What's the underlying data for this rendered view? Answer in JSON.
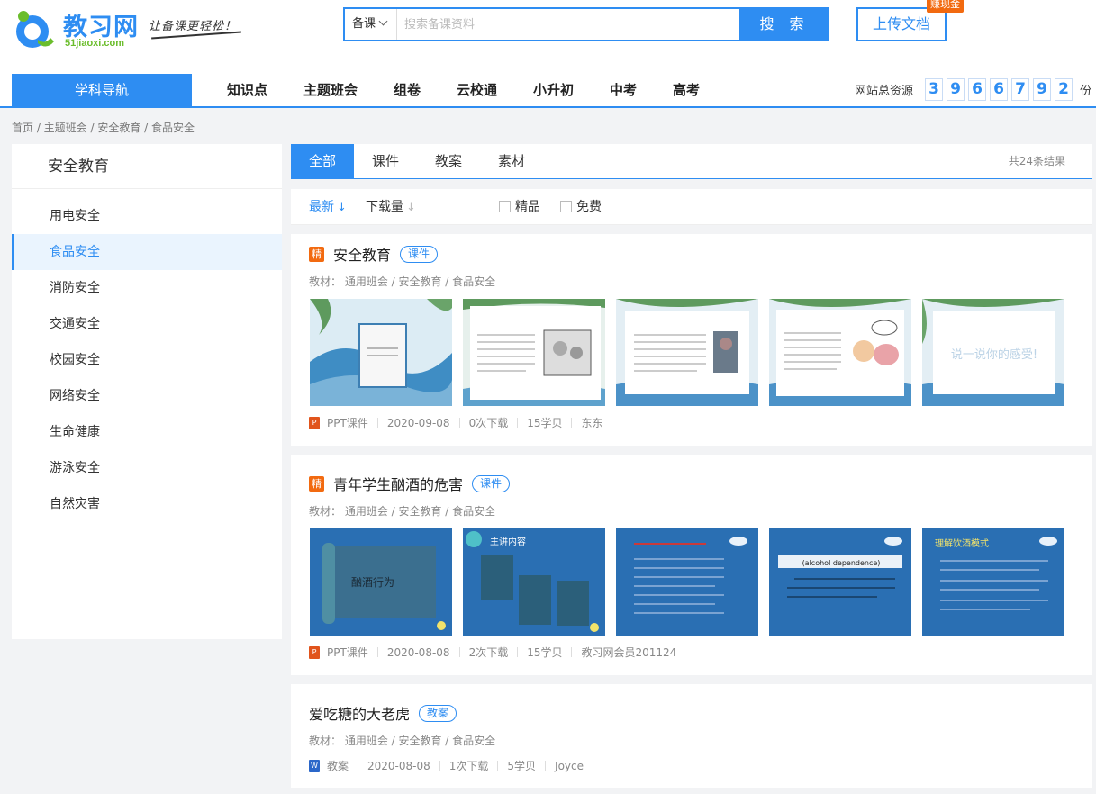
{
  "header": {
    "logo_text": "教习网",
    "logo_domain": "51jiaoxi.com",
    "slogan": "让备课更轻松！",
    "search": {
      "category": "备课",
      "placeholder": "搜索备课资料",
      "button": "搜 索"
    },
    "upload": {
      "label": "上传文档",
      "badge": "赚现金"
    }
  },
  "nav": {
    "subject_nav": "学科导航",
    "items": [
      "知识点",
      "主题班会",
      "组卷",
      "云校通",
      "小升初",
      "中考",
      "高考"
    ],
    "total_label": "网站总资源",
    "total_digits": [
      "3",
      "9",
      "6",
      "6",
      "7",
      "9",
      "2"
    ],
    "total_unit": "份"
  },
  "breadcrumb": "首页 /  主题班会 / 安全教育 / 食品安全",
  "sidebar": {
    "title": "安全教育",
    "items": [
      "用电安全",
      "食品安全",
      "消防安全",
      "交通安全",
      "校园安全",
      "网络安全",
      "生命健康",
      "游泳安全",
      "自然灾害"
    ],
    "active_index": 1
  },
  "tabs": {
    "items": [
      "全部",
      "课件",
      "教案",
      "素材"
    ],
    "active_index": 0,
    "result_count": "共24条结果"
  },
  "filters": {
    "sort_latest": "最新",
    "sort_downloads": "下载量",
    "premium": "精品",
    "free": "免费"
  },
  "results": [
    {
      "premium_badge": "精",
      "title": "安全教育",
      "type_tag": "课件",
      "meta": "教材：  通用班会   /  安全教育  /  食品安全",
      "file_type": "PPT课件",
      "date": "2020-09-08",
      "downloads": "0次下载",
      "price": "15学贝",
      "author": "东东",
      "thumb_texts": [
        "",
        "",
        "",
        "",
        "说一说你的感受!"
      ]
    },
    {
      "premium_badge": "精",
      "title": "青年学生酗酒的危害",
      "type_tag": "课件",
      "meta": "教材：  通用班会   /  安全教育  /  食品安全",
      "file_type": "PPT课件",
      "date": "2020-08-08",
      "downloads": "2次下载",
      "price": "15学贝",
      "author": "教习网会员201124",
      "thumb_texts": [
        "酗酒行为",
        "主讲内容",
        "",
        "(alcohol dependence)",
        "理解饮酒模式"
      ]
    },
    {
      "title": "爱吃糖的大老虎",
      "type_tag": "教案",
      "meta": "教材：  通用班会   /  安全教育  /  食品安全",
      "file_type": "教案",
      "date": "2020-08-08",
      "downloads": "1次下载",
      "price": "5学贝",
      "author": "Joyce"
    }
  ],
  "colors": {
    "primary": "#2e8df2",
    "accent": "#f26a10",
    "logo_green": "#6bbd2c"
  }
}
